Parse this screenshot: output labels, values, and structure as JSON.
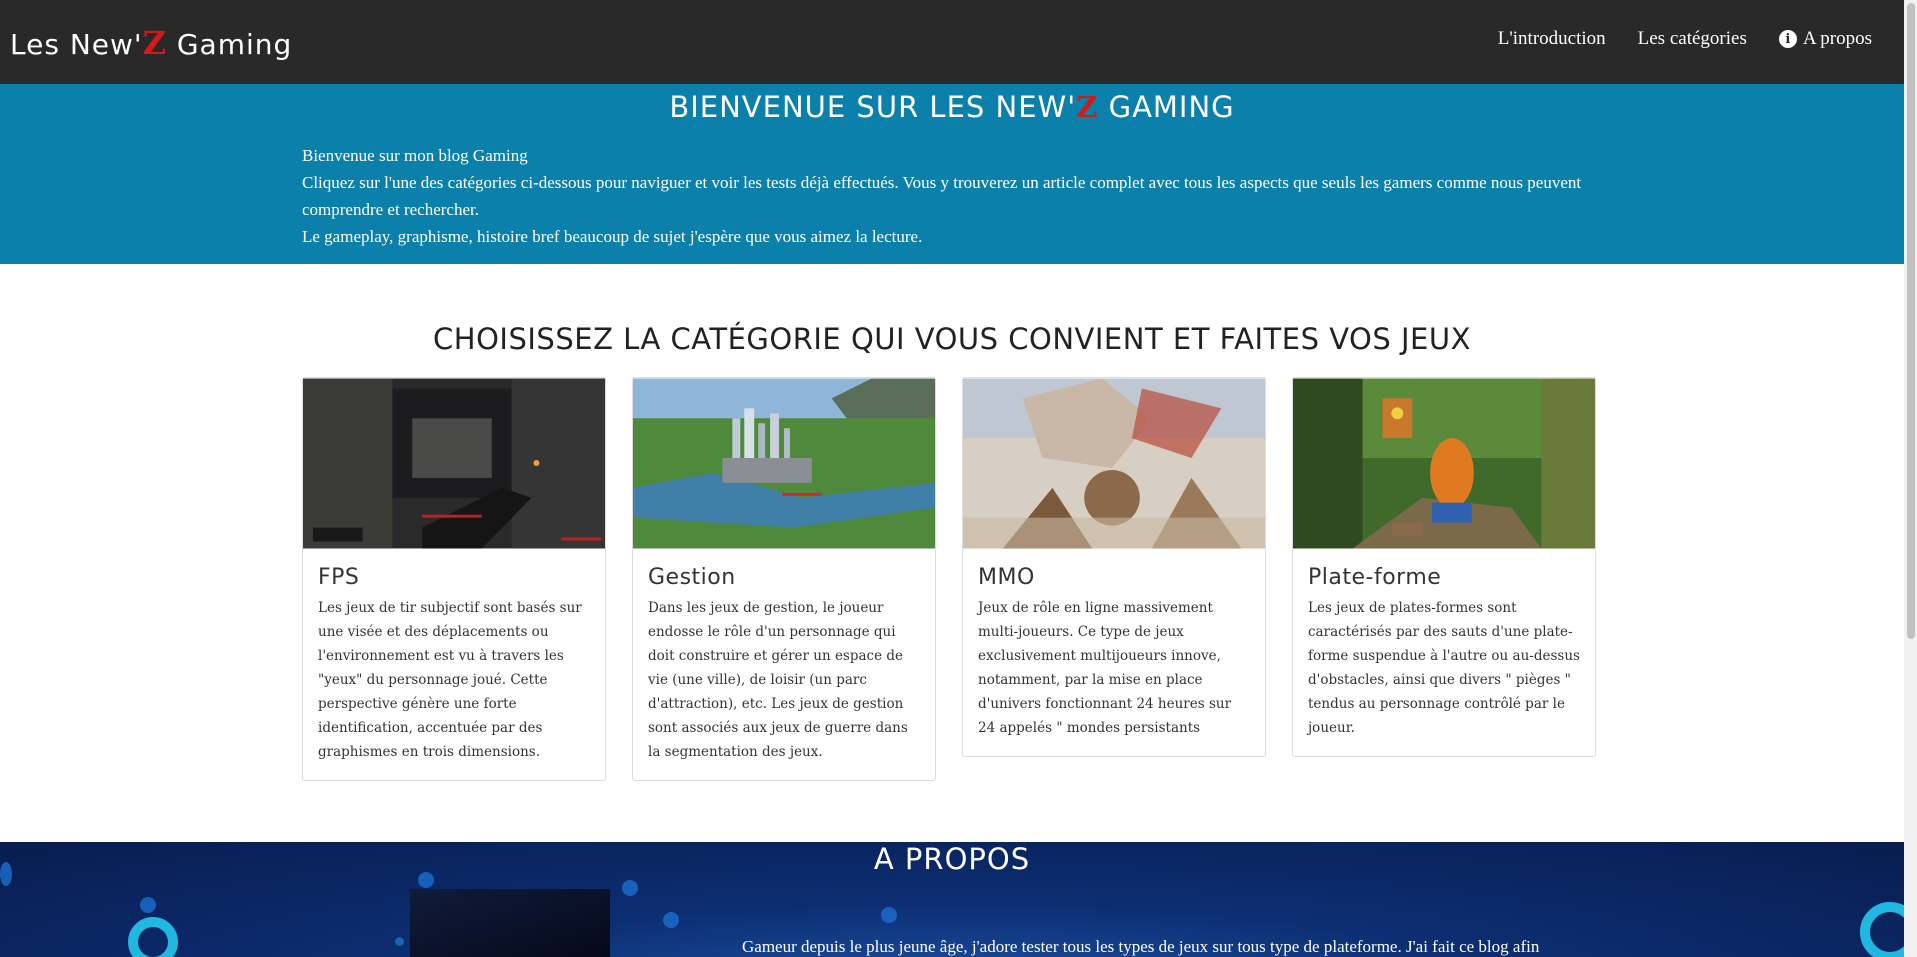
{
  "navbar": {
    "brand_prefix": "Les New'",
    "brand_z": "Z",
    "brand_suffix": " Gaming",
    "links": [
      {
        "label": "L'introduction"
      },
      {
        "label": "Les catégories"
      },
      {
        "label": "A propos",
        "icon": "info-icon"
      }
    ]
  },
  "hero": {
    "title_prefix": "BIENVENUE SUR LES NEW'",
    "title_z": "Z",
    "title_suffix": " GAMING",
    "paragraphs": [
      "Bienvenue sur mon blog Gaming",
      "Cliquez sur l'une des catégories ci-dessous pour naviguer et voir les tests déjà effectués. Vous y trouverez un article complet avec tous les aspects que seuls les gamers comme nous peuvent comprendre et rechercher.",
      "Le gameplay, graphisme, histoire bref beaucoup de sujet j'espère que vous aimez la lecture."
    ]
  },
  "categories": {
    "title": "CHOISISSEZ LA CATÉGORIE QUI VOUS CONVIENT ET FAITES VOS JEUX",
    "cards": [
      {
        "title": "FPS",
        "text": "Les jeux de tir subjectif sont basés sur une visée et des déplacements ou l'environnement est vu à travers les \"yeux\" du personnage joué. Cette perspective génère une forte identification, accentuée par des graphismes en trois dimensions."
      },
      {
        "title": "Gestion",
        "text": "Dans les jeux de gestion, le joueur endosse le rôle d'un personnage qui doit construire et gérer un espace de vie (une ville), de loisir (un parc d'attraction), etc. Les jeux de gestion sont associés aux jeux de guerre dans la segmentation des jeux."
      },
      {
        "title": "MMO",
        "text": "Jeux de rôle en ligne massivement multi-joueurs. Ce type de jeux exclusivement multijoueurs innove, notamment, par la mise en place d'univers fonctionnant 24 heures sur 24 appelés \" mondes persistants"
      },
      {
        "title": "Plate-forme",
        "text": "Les jeux de plates-formes sont caractérisés par des sauts d'une plate-forme suspendue à l'autre ou au-dessus d'obstacles, ainsi que divers \" pièges \" tendus au personnage contrôlé par le joueur."
      }
    ]
  },
  "apropos": {
    "title": "A PROPOS",
    "text": "Gameur depuis le plus jeune âge, j'adore tester tous les types de jeux sur tous type de plateforme. J'ai fait ce blog afin"
  },
  "colors": {
    "navbar": "#292929",
    "hero": "#0b80aa",
    "accent_z": "#d21a1a",
    "apropos": "#0c2e72"
  }
}
